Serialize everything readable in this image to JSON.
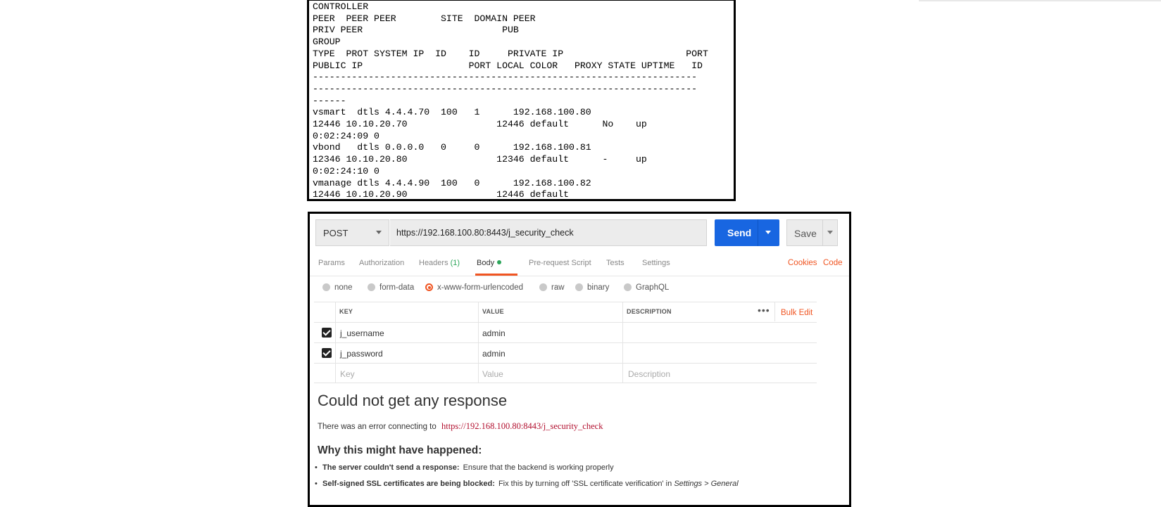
{
  "terminal": {
    "lines": [
      "CONTROLLER",
      "PEER  PEER PEER        SITE  DOMAIN PEER",
      "PRIV PEER                         PUB",
      "GROUP",
      "TYPE  PROT SYSTEM IP  ID    ID     PRIVATE IP                      PORT",
      "PUBLIC IP                   PORT LOCAL COLOR   PROXY STATE UPTIME   ID",
      "---------------------------------------------------------------------",
      "---------------------------------------------------------------------",
      "------",
      "vsmart  dtls 4.4.4.70  100   1      192.168.100.80",
      "12446 10.10.20.70                12446 default      No    up",
      "0:02:24:09 0",
      "vbond   dtls 0.0.0.0   0     0      192.168.100.81",
      "12346 10.10.20.80                12346 default      -     up",
      "0:02:24:10 0",
      "vmanage dtls 4.4.4.90  100   0      192.168.100.82",
      "12446 10.10.20.90                12446 default"
    ]
  },
  "request": {
    "method": "POST",
    "url": "https://192.168.100.80:8443/j_security_check",
    "send_label": "Send",
    "save_label": "Save"
  },
  "tabs": {
    "params": "Params",
    "authorization": "Authorization",
    "headers": "Headers",
    "headers_count": "(1)",
    "body": "Body",
    "prerequest": "Pre-request Script",
    "tests": "Tests",
    "settings": "Settings",
    "cookies": "Cookies",
    "code": "Code"
  },
  "body_types": {
    "none": "none",
    "form_data": "form-data",
    "urlencoded": "x-www-form-urlencoded",
    "raw": "raw",
    "binary": "binary",
    "graphql": "GraphQL",
    "selected": "x-www-form-urlencoded"
  },
  "kv": {
    "headers": {
      "key": "KEY",
      "value": "VALUE",
      "description": "DESCRIPTION",
      "bulk_edit": "Bulk Edit",
      "more": "•••"
    },
    "rows": [
      {
        "key": "j_username",
        "value": "admin"
      },
      {
        "key": "j_password",
        "value": "admin"
      }
    ],
    "placeholder": {
      "key": "Key",
      "value": "Value",
      "description": "Description"
    }
  },
  "response": {
    "title": "Could not get any response",
    "error_prefix": "There was an error connecting to",
    "error_url": "https://192.168.100.80:8443/j_security_check",
    "why_title": "Why this might have happened:",
    "reasons": [
      {
        "bold": "The server couldn't send a response:",
        "text": "Ensure that the backend is working properly"
      },
      {
        "bold": "Self-signed SSL certificates are being blocked:",
        "text": "Fix this by turning off 'SSL certificate verification' in",
        "italic": "Settings > General"
      }
    ]
  }
}
